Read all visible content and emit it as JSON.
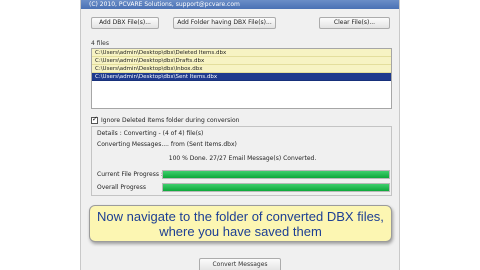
{
  "header": {
    "copyright": "(C) 2010, PCVARE Solutions, support@pcvare.com"
  },
  "toolbar": {
    "add_files_label": "Add DBX File(s)...",
    "add_folder_label": "Add Folder having DBX File(s)...",
    "clear_label": "Clear File(s)..."
  },
  "file_list": {
    "count_label": "4 files",
    "items": [
      "C:\\Users\\admin\\Desktop\\dbx\\Deleted Items.dbx",
      "C:\\Users\\admin\\Desktop\\dbx\\Drafts.dbx",
      "C:\\Users\\admin\\Desktop\\dbx\\Inbox.dbx",
      "C:\\Users\\admin\\Desktop\\dbx\\Sent Items.dbx"
    ],
    "selected_index": 3
  },
  "options": {
    "ignore_deleted_label": "Ignore Deleted Items folder during conversion",
    "ignore_deleted_checked": true
  },
  "details": {
    "title": "Details : Converting - (4 of 4) file(s)",
    "converting_message": "Converting Messages.... from (Sent Items.dbx)",
    "done_message": "100 % Done. 27/27 Email Message(s) Converted.",
    "current_label": "Current File Progress :",
    "overall_label": "Overall Progress",
    "current_progress": 1.0,
    "overall_progress": 1.0
  },
  "footer": {
    "extra_option": "",
    "convert_label": "Convert Messages"
  },
  "callout": {
    "text": "Now navigate to the folder of converted DBX files, where you have saved them"
  },
  "colors": {
    "selected_row": "#1f3a8e",
    "file_row": "#f7f3c3",
    "progress_fill": "#0da83a",
    "callout_bg": "#fcf6b2",
    "callout_text": "#1d3f94"
  }
}
